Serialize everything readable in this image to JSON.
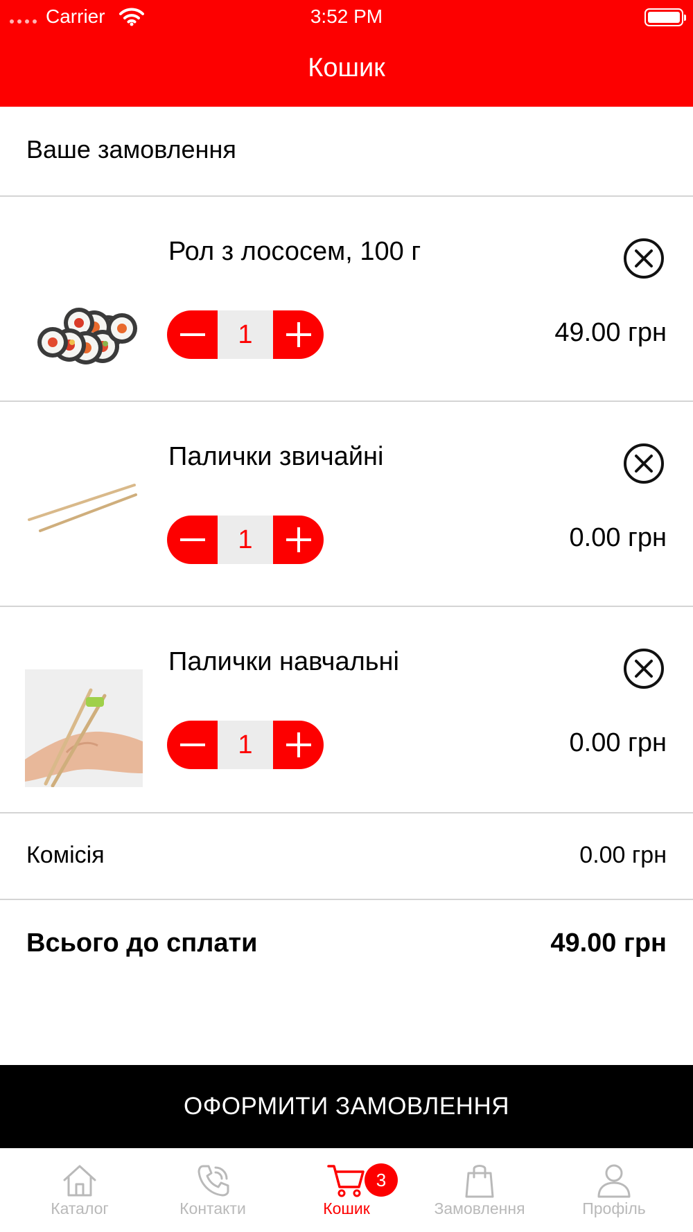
{
  "status_bar": {
    "carrier": "Carrier",
    "time": "3:52 PM"
  },
  "nav": {
    "title": "Кошик"
  },
  "order": {
    "heading": "Ваше замовлення",
    "items": [
      {
        "name": "Рол з лососем, 100 г",
        "qty": "1",
        "price": "49.00 грн",
        "image": "salmon-roll-image"
      },
      {
        "name": "Палички звичайні",
        "qty": "1",
        "price": "0.00 грн",
        "image": "chopsticks-image"
      },
      {
        "name": "Палички навчальні",
        "qty": "1",
        "price": "0.00 грн",
        "image": "training-chopsticks-image"
      }
    ]
  },
  "summary": {
    "fee_label": "Комісія",
    "fee_value": "0.00 грн",
    "total_label": "Всього до сплати",
    "total_value": "49.00 грн"
  },
  "checkout_button": "ОФОРМИТИ ЗАМОВЛЕННЯ",
  "tabs": [
    {
      "label": "Каталог",
      "icon": "home-icon"
    },
    {
      "label": "Контакти",
      "icon": "phone-icon"
    },
    {
      "label": "Кошик",
      "icon": "cart-icon",
      "active": true,
      "badge": "3"
    },
    {
      "label": "Замовлення",
      "icon": "bag-icon"
    },
    {
      "label": "Профіль",
      "icon": "user-icon"
    }
  ],
  "colors": {
    "accent": "#fd0000",
    "checkout_bg": "#000000",
    "inactive_tab": "#b9b9b9",
    "qty_bg": "#ececec"
  }
}
